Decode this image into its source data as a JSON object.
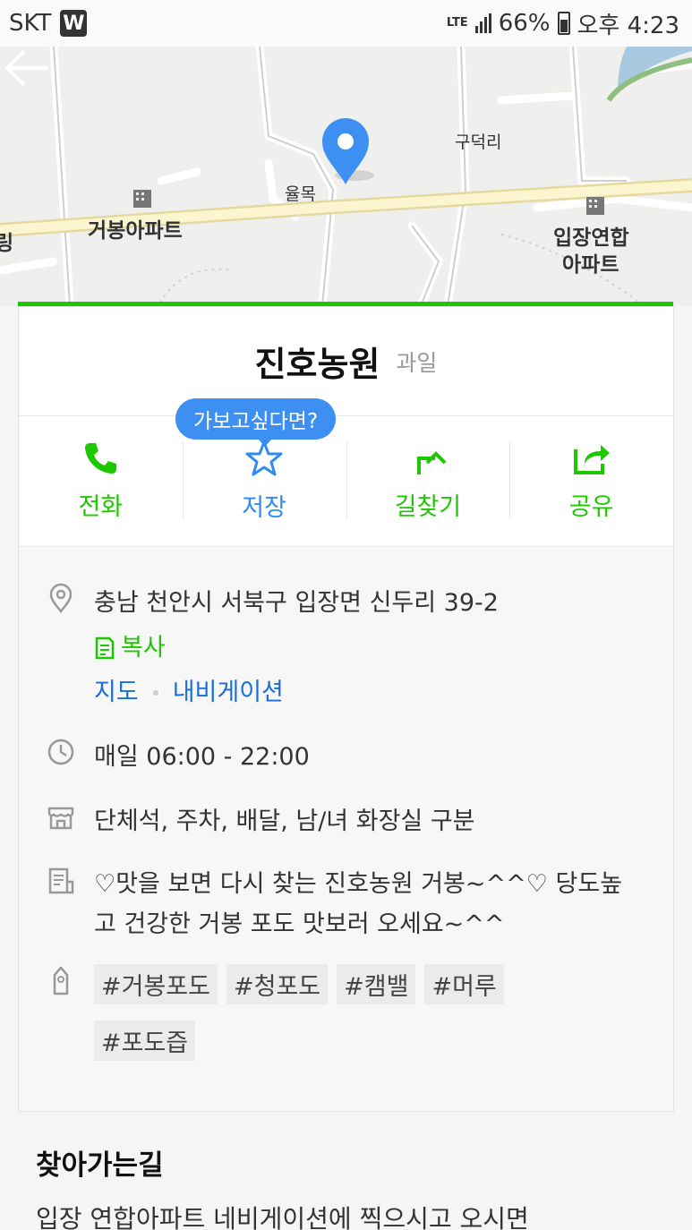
{
  "status_bar": {
    "carrier": "SKT",
    "app_badge": "W",
    "network": "LTE",
    "battery": "66%",
    "time": "오후 4:23"
  },
  "map": {
    "labels": {
      "left_edge": "링",
      "apt_left": "거봉아파트",
      "village": "율목",
      "district": "구덕리",
      "apt_right_1": "입장연합",
      "apt_right_2": "아파트"
    },
    "icons": [
      "back-arrow-icon",
      "location-pin-icon",
      "building-icon"
    ]
  },
  "place": {
    "name": "진호농원",
    "category": "과일"
  },
  "actions": {
    "tooltip": "가보고싶다면?",
    "call": "전화",
    "save": "저장",
    "directions": "길찾기",
    "share": "공유"
  },
  "info": {
    "address": "충남 천안시 서북구 입장면 신두리 39-2",
    "copy": "복사",
    "map_link": "지도",
    "navi_link": "내비게이션",
    "hours": "매일 06:00 - 22:00",
    "facilities": "단체석, 주차, 배달, 남/녀 화장실 구분",
    "description": "♡맛을 보면 다시 찾는 진호농원 거봉~^^♡ 당도높고 건강한 거봉 포도  맛보러 오세요~^^",
    "tags": [
      "#거봉포도",
      "#청포도",
      "#캠밸",
      "#머루",
      "#포도즙"
    ]
  },
  "directions_section": {
    "title": "찾아가는길",
    "body": "입장  연합아파트  네비게이션에  찍으시고  오시면"
  },
  "colors": {
    "naver_green": "#1ec800",
    "blue": "#2e8bf2",
    "link_blue": "#1a6ed8"
  }
}
